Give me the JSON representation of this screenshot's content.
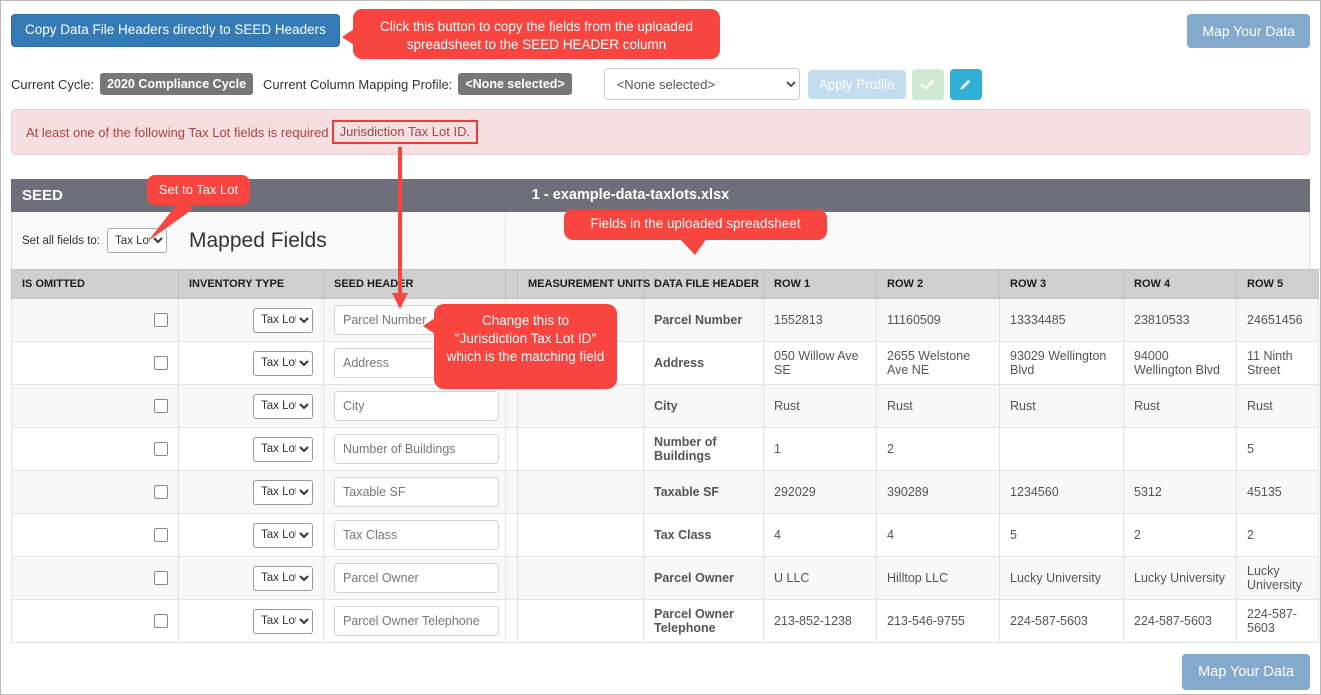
{
  "toolbar": {
    "copy_headers_label": "Copy Data File Headers directly to SEED Headers",
    "map_your_data_top": "Map Your Data",
    "map_your_data_bottom": "Map Your Data"
  },
  "cycle_row": {
    "current_cycle_label": "Current Cycle:",
    "current_cycle_value": "2020 Compliance Cycle",
    "mapping_profile_label": "Current Column Mapping Profile:",
    "mapping_profile_value": "<None selected>",
    "profile_select_value": "<None selected>",
    "apply_profile_label": "Apply Profile",
    "ok_icon": "check-icon",
    "edit_icon": "pencil-icon"
  },
  "alert": {
    "text": "At least one of the following Tax Lot fields is required",
    "highlight": "Jurisdiction Tax Lot ID."
  },
  "seed_band": {
    "left_title": "SEED",
    "file_title": "1 - example-data-taxlots.xlsx"
  },
  "mapped_row": {
    "set_all_label": "Set all fields to:",
    "set_all_value": "Tax Lot",
    "mapped_fields_title": "Mapped Fields"
  },
  "table": {
    "columns": [
      "IS OMITTED",
      "INVENTORY TYPE",
      "SEED HEADER",
      "",
      "MEASUREMENT UNITS",
      "DATA FILE HEADER",
      "ROW 1",
      "ROW 2",
      "ROW 3",
      "ROW 4",
      "ROW 5"
    ],
    "rows": [
      {
        "is_omitted": false,
        "inventory_type": "Tax Lot",
        "seed_header": "Parcel Number",
        "measurement_units": "",
        "data_file_header": "Parcel Number",
        "row1": "1552813",
        "row2": "11160509",
        "row3": "13334485",
        "row4": "23810533",
        "row5": "24651456"
      },
      {
        "is_omitted": false,
        "inventory_type": "Tax Lot",
        "seed_header": "Address",
        "measurement_units": "",
        "data_file_header": "Address",
        "row1": "050 Willow Ave SE",
        "row2": "2655 Welstone Ave NE",
        "row3": "93029 Wellington Blvd",
        "row4": "94000 Wellington Blvd",
        "row5": "11 Ninth Street"
      },
      {
        "is_omitted": false,
        "inventory_type": "Tax Lot",
        "seed_header": "City",
        "measurement_units": "",
        "data_file_header": "City",
        "row1": "Rust",
        "row2": "Rust",
        "row3": "Rust",
        "row4": "Rust",
        "row5": "Rust"
      },
      {
        "is_omitted": false,
        "inventory_type": "Tax Lot",
        "seed_header": "Number of Buildings",
        "measurement_units": "",
        "data_file_header": "Number of Buildings",
        "row1": "1",
        "row2": "2",
        "row3": "",
        "row4": "",
        "row5": "5"
      },
      {
        "is_omitted": false,
        "inventory_type": "Tax Lot",
        "seed_header": "Taxable SF",
        "measurement_units": "",
        "data_file_header": "Taxable SF",
        "row1": "292029",
        "row2": "390289",
        "row3": "1234560",
        "row4": "5312",
        "row5": "45135"
      },
      {
        "is_omitted": false,
        "inventory_type": "Tax Lot",
        "seed_header": "Tax Class",
        "measurement_units": "",
        "data_file_header": "Tax Class",
        "row1": "4",
        "row2": "4",
        "row3": "5",
        "row4": "2",
        "row5": "2"
      },
      {
        "is_omitted": false,
        "inventory_type": "Tax Lot",
        "seed_header": "Parcel Owner",
        "measurement_units": "",
        "data_file_header": "Parcel Owner",
        "row1": "U LLC",
        "row2": "Hilltop LLC",
        "row3": "Lucky University",
        "row4": "Lucky University",
        "row5": "Lucky University"
      },
      {
        "is_omitted": false,
        "inventory_type": "Tax Lot",
        "seed_header": "Parcel Owner Telephone",
        "measurement_units": "",
        "data_file_header": "Parcel Owner Telephone",
        "row1": "213-852-1238",
        "row2": "213-546-9755",
        "row3": "224-587-5603",
        "row4": "224-587-5603",
        "row5": "224-587-5603"
      }
    ]
  },
  "callouts": {
    "copy_button": "Click this button to copy the fields from the uploaded spreadsheet to the SEED HEADER column",
    "set_tax_lot": "Set to Tax Lot",
    "uploaded_fields": "Fields in the uploaded spreadsheet",
    "change_this": "Change this to \"Jurisdiction Tax Lot ID\" which is the matching field"
  },
  "colors": {
    "accent_red": "#f9453f",
    "primary_blue": "#337ab7",
    "muted_blue": "#84a9cc",
    "band_grey": "#6f6f7b",
    "alert_bg": "#f6dfe0"
  }
}
